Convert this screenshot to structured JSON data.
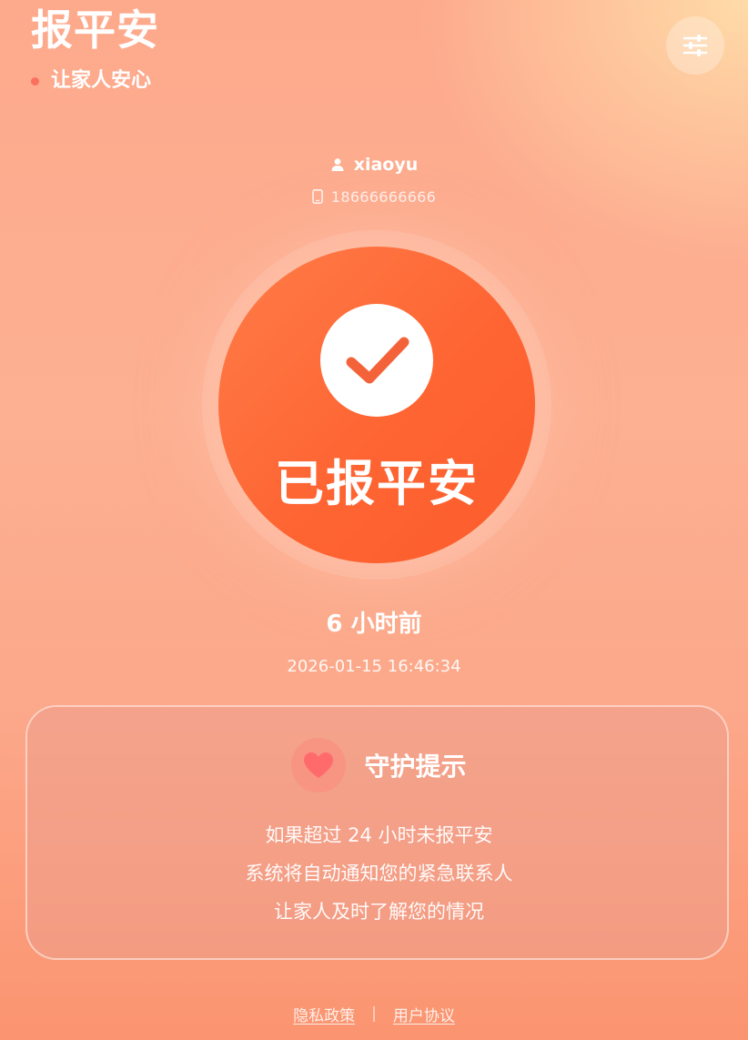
{
  "header": {
    "title": "报平安",
    "subtitle": "让家人安心",
    "settings_icon": "sliders-icon"
  },
  "user": {
    "name": "xiaoyu",
    "phone": "18666666666",
    "user_icon": "person-icon",
    "phone_icon": "phone-icon"
  },
  "checkin": {
    "label": "已报平安",
    "icon": "checkmark-icon",
    "time_ago": "6 小时前",
    "timestamp": "2026-01-15 16:46:34"
  },
  "guard_card": {
    "icon": "heart-icon",
    "title": "守护提示",
    "lines": [
      "如果超过 24 小时未报平安",
      "系统将自动通知您的紧急联系人",
      "让家人及时了解您的情况"
    ]
  },
  "footer": {
    "privacy_label": "隐私政策",
    "separator": "|",
    "agreement_label": "用户协议"
  },
  "colors": {
    "accent": "#fe6533",
    "dot": "#fb6f5e",
    "heart": "#ff6b6b"
  }
}
